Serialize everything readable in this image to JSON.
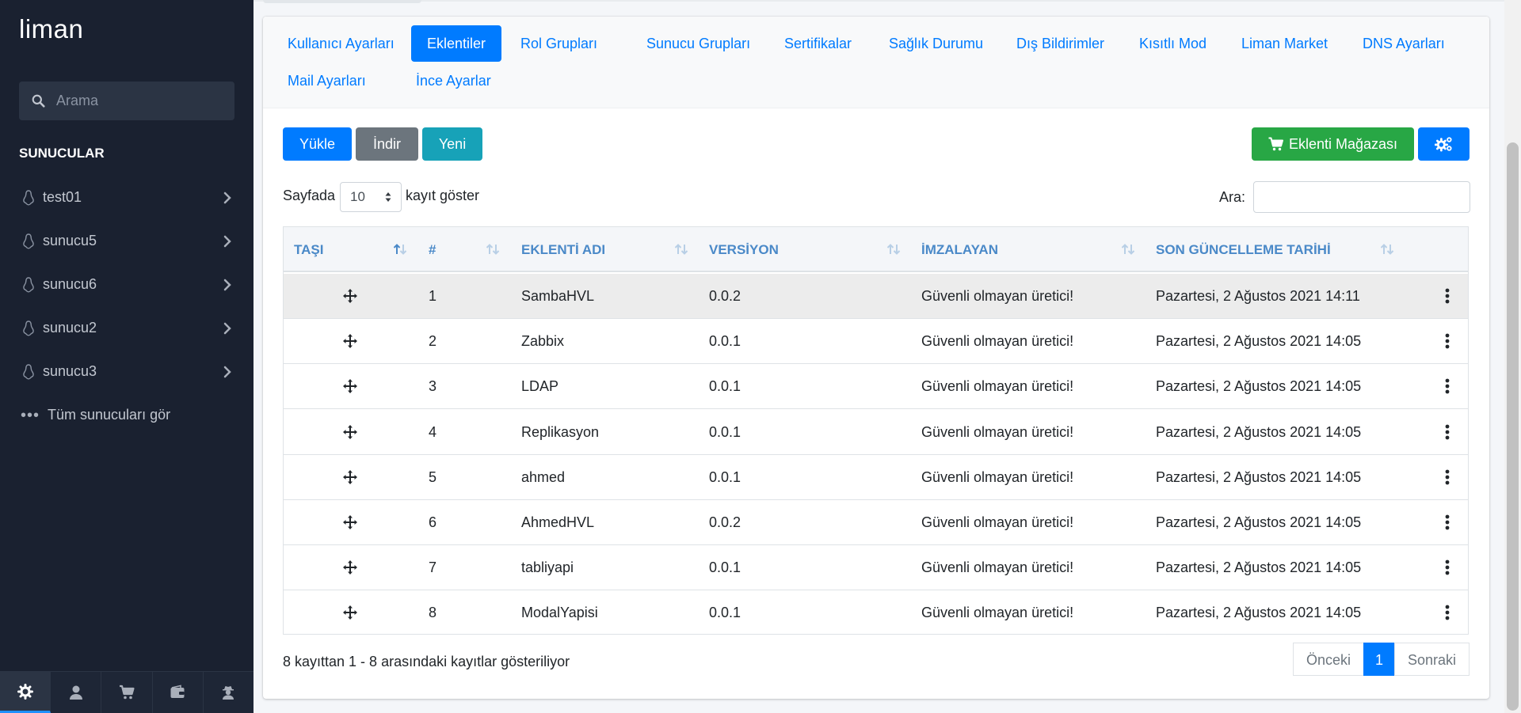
{
  "app": {
    "logo": "liman"
  },
  "sidebar": {
    "search_placeholder": "Arama",
    "section_title": "SUNUCULAR",
    "servers": [
      {
        "name": "test01"
      },
      {
        "name": "sunucu5"
      },
      {
        "name": "sunucu6"
      },
      {
        "name": "sunucu2"
      },
      {
        "name": "sunucu3"
      }
    ],
    "all_servers_label": "Tüm sunucuları gör",
    "bottom_icons": [
      "gear-icon",
      "user-icon",
      "cart-icon",
      "wallet-icon",
      "user-secret-icon"
    ]
  },
  "tabs": [
    {
      "label": "Kullanıcı Ayarları",
      "active": false
    },
    {
      "label": "Eklentiler",
      "active": true
    },
    {
      "label": "Rol Grupları",
      "active": false
    },
    {
      "label": "Sunucu Grupları",
      "active": false
    },
    {
      "label": "Sertifikalar",
      "active": false
    },
    {
      "label": "Sağlık Durumu",
      "active": false
    },
    {
      "label": "Dış Bildirimler",
      "active": false
    },
    {
      "label": "Kısıtlı Mod",
      "active": false
    },
    {
      "label": "Liman Market",
      "active": false
    },
    {
      "label": "DNS Ayarları",
      "active": false
    },
    {
      "label": "Mail Ayarları",
      "active": false
    },
    {
      "label": "İnce Ayarlar",
      "active": false
    }
  ],
  "toolbar": {
    "upload_label": "Yükle",
    "download_label": "İndir",
    "new_label": "Yeni",
    "store_label": "Eklenti Mağazası"
  },
  "table_controls": {
    "page_prefix": "Sayfada",
    "page_size": "10",
    "page_suffix": "kayıt göster",
    "search_label": "Ara:"
  },
  "table": {
    "columns": [
      "TAŞI",
      "#",
      "EKLENTİ ADI",
      "VERSİYON",
      "İMZALAYAN",
      "SON GÜNCELLEME TARİHİ"
    ],
    "rows": [
      {
        "num": "1",
        "name": "SambaHVL",
        "version": "0.0.2",
        "signer": "Güvenli olmayan üretici!",
        "updated": "Pazartesi, 2 Ağustos 2021 14:11"
      },
      {
        "num": "2",
        "name": "Zabbix",
        "version": "0.0.1",
        "signer": "Güvenli olmayan üretici!",
        "updated": "Pazartesi, 2 Ağustos 2021 14:05"
      },
      {
        "num": "3",
        "name": "LDAP",
        "version": "0.0.1",
        "signer": "Güvenli olmayan üretici!",
        "updated": "Pazartesi, 2 Ağustos 2021 14:05"
      },
      {
        "num": "4",
        "name": "Replikasyon",
        "version": "0.0.1",
        "signer": "Güvenli olmayan üretici!",
        "updated": "Pazartesi, 2 Ağustos 2021 14:05"
      },
      {
        "num": "5",
        "name": "ahmed",
        "version": "0.0.1",
        "signer": "Güvenli olmayan üretici!",
        "updated": "Pazartesi, 2 Ağustos 2021 14:05"
      },
      {
        "num": "6",
        "name": "AhmedHVL",
        "version": "0.0.2",
        "signer": "Güvenli olmayan üretici!",
        "updated": "Pazartesi, 2 Ağustos 2021 14:05"
      },
      {
        "num": "7",
        "name": "tabliyapi",
        "version": "0.0.1",
        "signer": "Güvenli olmayan üretici!",
        "updated": "Pazartesi, 2 Ağustos 2021 14:05"
      },
      {
        "num": "8",
        "name": "ModalYapisi",
        "version": "0.0.1",
        "signer": "Güvenli olmayan üretici!",
        "updated": "Pazartesi, 2 Ağustos 2021 14:05"
      }
    ]
  },
  "footer": {
    "info": "8 kayıttan 1 - 8 arasındaki kayıtlar gösteriliyor",
    "prev_label": "Önceki",
    "current_page": "1",
    "next_label": "Sonraki"
  },
  "colors": {
    "sidebar_bg": "#1a2130",
    "primary": "#007bff",
    "success": "#28a745",
    "info": "#17a2b8",
    "secondary": "#6c757d",
    "header_text": "#4a89c8"
  }
}
